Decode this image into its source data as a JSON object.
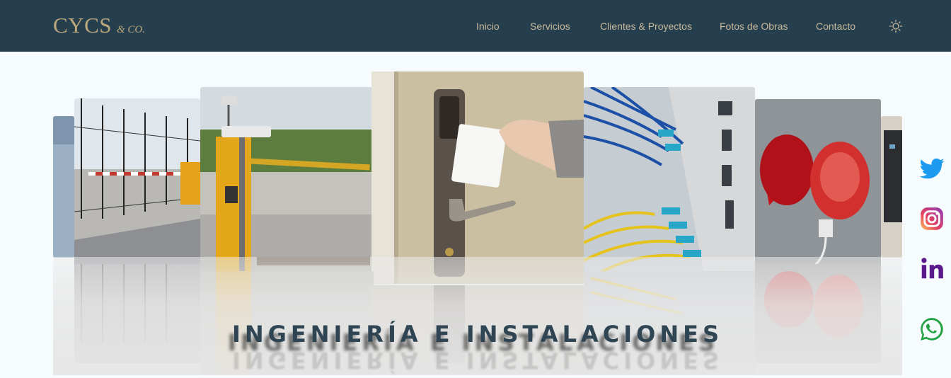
{
  "brand": {
    "name": "CYCS",
    "suffix": "& CO."
  },
  "nav": {
    "items": [
      {
        "label": "Inicio"
      },
      {
        "label": "Servicios"
      },
      {
        "label": "Clientes & Proyectos"
      },
      {
        "label": "Fotos de Obras"
      },
      {
        "label": "Contacto"
      }
    ],
    "theme_icon": "sun-icon"
  },
  "carousel": {
    "banner_text": "INGENIERÍA E INSTALACIONES",
    "slides": [
      {
        "subject": "barrier-gate-fence"
      },
      {
        "subject": "parking-barrier-camera"
      },
      {
        "subject": "hand-keycard-door-lock"
      },
      {
        "subject": "network-fiber-cables"
      },
      {
        "subject": "red-alarm-sirens"
      },
      {
        "subject": "access-control-keypad"
      }
    ]
  },
  "social": [
    {
      "name": "twitter",
      "icon": "twitter-icon"
    },
    {
      "name": "instagram",
      "icon": "instagram-icon"
    },
    {
      "name": "linkedin",
      "icon": "linkedin-icon"
    },
    {
      "name": "whatsapp",
      "icon": "whatsapp-icon"
    }
  ],
  "colors": {
    "navbar": "#263f4e",
    "brand": "#bda77c",
    "nav_link": "#c8b898",
    "banner": "#2f4553",
    "page_bg": "#f6fbfd"
  }
}
